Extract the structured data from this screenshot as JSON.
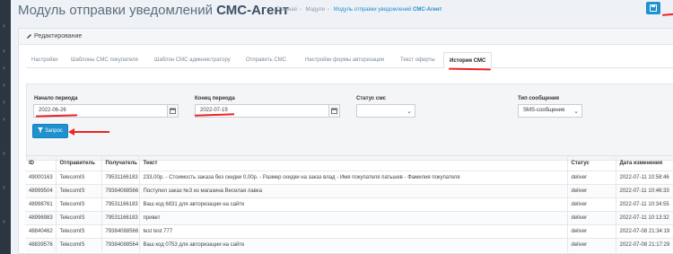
{
  "header": {
    "title_prefix": "Модуль отправки уведомлений ",
    "title_bold": "СМС-Агент",
    "breadcrumb": [
      "Главная",
      "Модули",
      "Модуль отправки уведомлений"
    ],
    "breadcrumb_current": "СМС-Агент"
  },
  "panel": {
    "heading": "Редактирование"
  },
  "tabs": [
    {
      "label": "Настройки"
    },
    {
      "label": "Шаблоны СМС покупателя"
    },
    {
      "label": "Шаблон СМС администратору"
    },
    {
      "label": "Отправить СМС"
    },
    {
      "label": "Настройки формы авторизации"
    },
    {
      "label": "Текст оферты"
    },
    {
      "label": "История СМС"
    }
  ],
  "filters": {
    "start_label": "Начало периода",
    "start_value": "2022-06-26",
    "end_label": "Конец периода",
    "end_value": "2022-07-19",
    "status_label": "Статус смс",
    "status_value": "",
    "type_label": "Тип сообщения",
    "type_value": "SMS-сообщения",
    "query_button": "Запрос"
  },
  "table": {
    "headers": {
      "id": "ID",
      "sender": "Отправитель",
      "recipient": "Получатель",
      "text": "Текст",
      "status": "Статус",
      "date": "Дата изменения"
    },
    "rows": [
      {
        "id": "49000163",
        "sender": "TelecomIS",
        "recipient": "79531166183",
        "text": "233,00р. - Стоимость заказа без скидки 0,00р. - Размер скидки на заказ влад - Имя покупателя патьшев - Фамилия покупателя",
        "status": "deliver",
        "date": "2022-07-11 10:58:46"
      },
      {
        "id": "48999504",
        "sender": "TelecomIS",
        "recipient": "79384088566",
        "text": "Поступил заказ №3 из магазина Веселая лавка",
        "status": "deliver",
        "date": "2022-07-11 10:46:33"
      },
      {
        "id": "48998761",
        "sender": "TelecomIS",
        "recipient": "79531166183",
        "text": "Ваш код 6831 для авторизации на сайте",
        "status": "deliver",
        "date": "2022-07-11 10:34:55"
      },
      {
        "id": "48996983",
        "sender": "TelecomIS",
        "recipient": "79531166183",
        "text": "привет",
        "status": "deliver",
        "date": "2022-07-11 10:13:32"
      },
      {
        "id": "48840462",
        "sender": "TelecomIS",
        "recipient": "79384088566",
        "text": "test test 777",
        "status": "deliver",
        "date": "2022-07-08 21:34:19"
      },
      {
        "id": "48839576",
        "sender": "TelecomIS",
        "recipient": "79384088564",
        "text": "Ваш код 0753 для авторизации на сайте",
        "status": "deliver",
        "date": "2022-07-08 21:17:29"
      }
    ]
  },
  "colors": {
    "accent": "#1e91cf",
    "annotation_red": "#e22",
    "sidebar": "#2b3640"
  }
}
